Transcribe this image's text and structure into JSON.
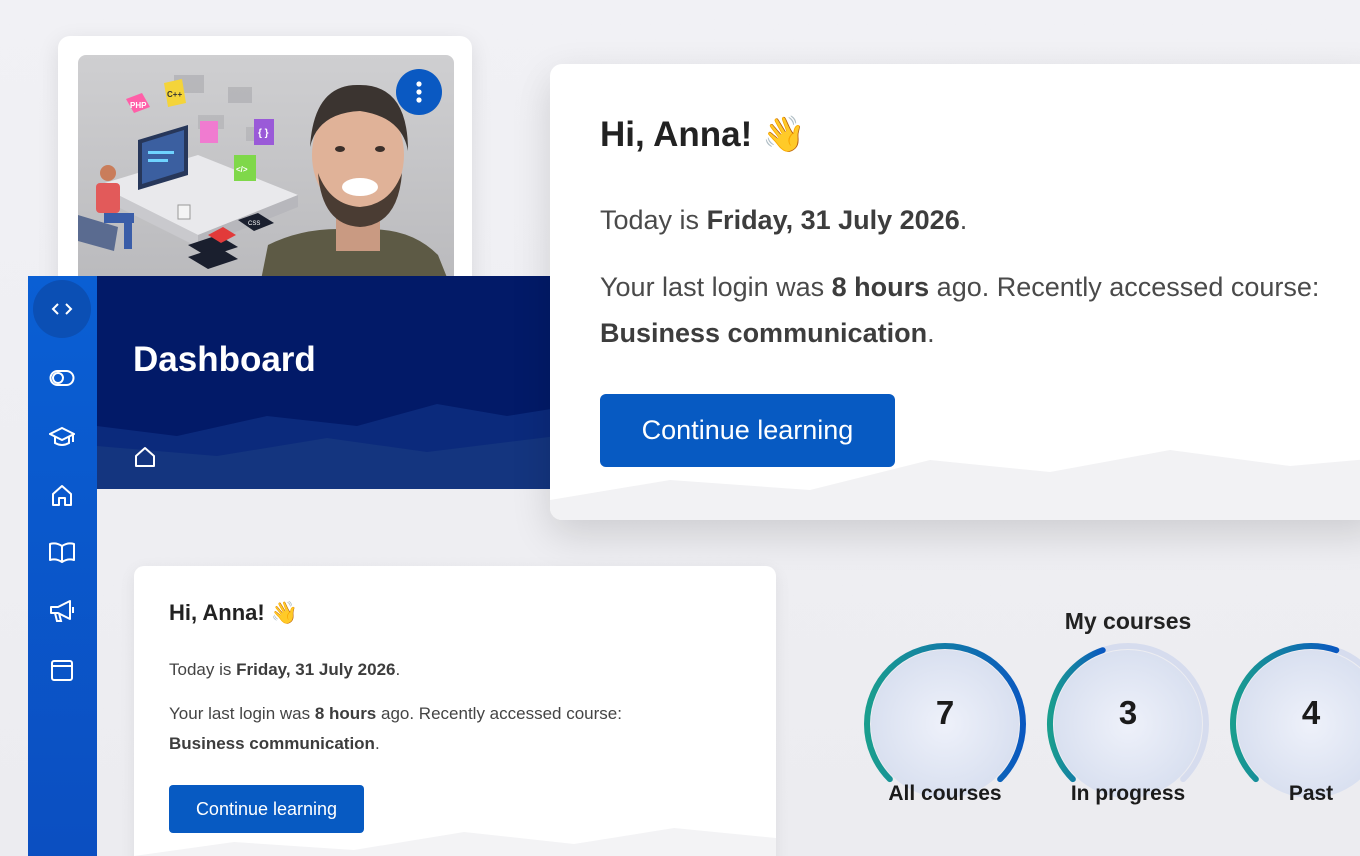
{
  "course_card": {
    "thumbnail_tags": [
      "PHP",
      "C++",
      "{ }",
      "</>",
      "CSS"
    ]
  },
  "dashboard": {
    "title": "Dashboard"
  },
  "welcome": {
    "greeting": "Hi, Anna!",
    "wave_emoji": "👋",
    "today_prefix": "Today is ",
    "today_date": "Friday, 31 July 2026",
    "today_suffix": ".",
    "login_prefix": "Your last login was ",
    "login_time": "8 hours",
    "login_middle": " ago. Recently accessed course:",
    "recent_course": "Business communication",
    "recent_suffix": ".",
    "button_label": "Continue learning"
  },
  "sidebar": {
    "icons": [
      "collapse-toggle-icon",
      "toggle-icon",
      "graduation-cap-icon",
      "home-icon",
      "book-icon",
      "megaphone-icon",
      "calendar-icon"
    ]
  },
  "my_courses": {
    "title": "My courses",
    "gauges": [
      {
        "label": "All courses",
        "value": "7",
        "fill": 1.0
      },
      {
        "label": "In progress",
        "value": "3",
        "fill": 0.43
      },
      {
        "label": "Past",
        "value": "4",
        "fill": 0.57
      }
    ],
    "colors": {
      "start": "#1a9e8e",
      "end": "#0a58c0",
      "track": "#d6dcee"
    }
  },
  "colors": {
    "primary": "#075ac2",
    "header": "#021a68",
    "sidebar": "#0a5fd4"
  }
}
